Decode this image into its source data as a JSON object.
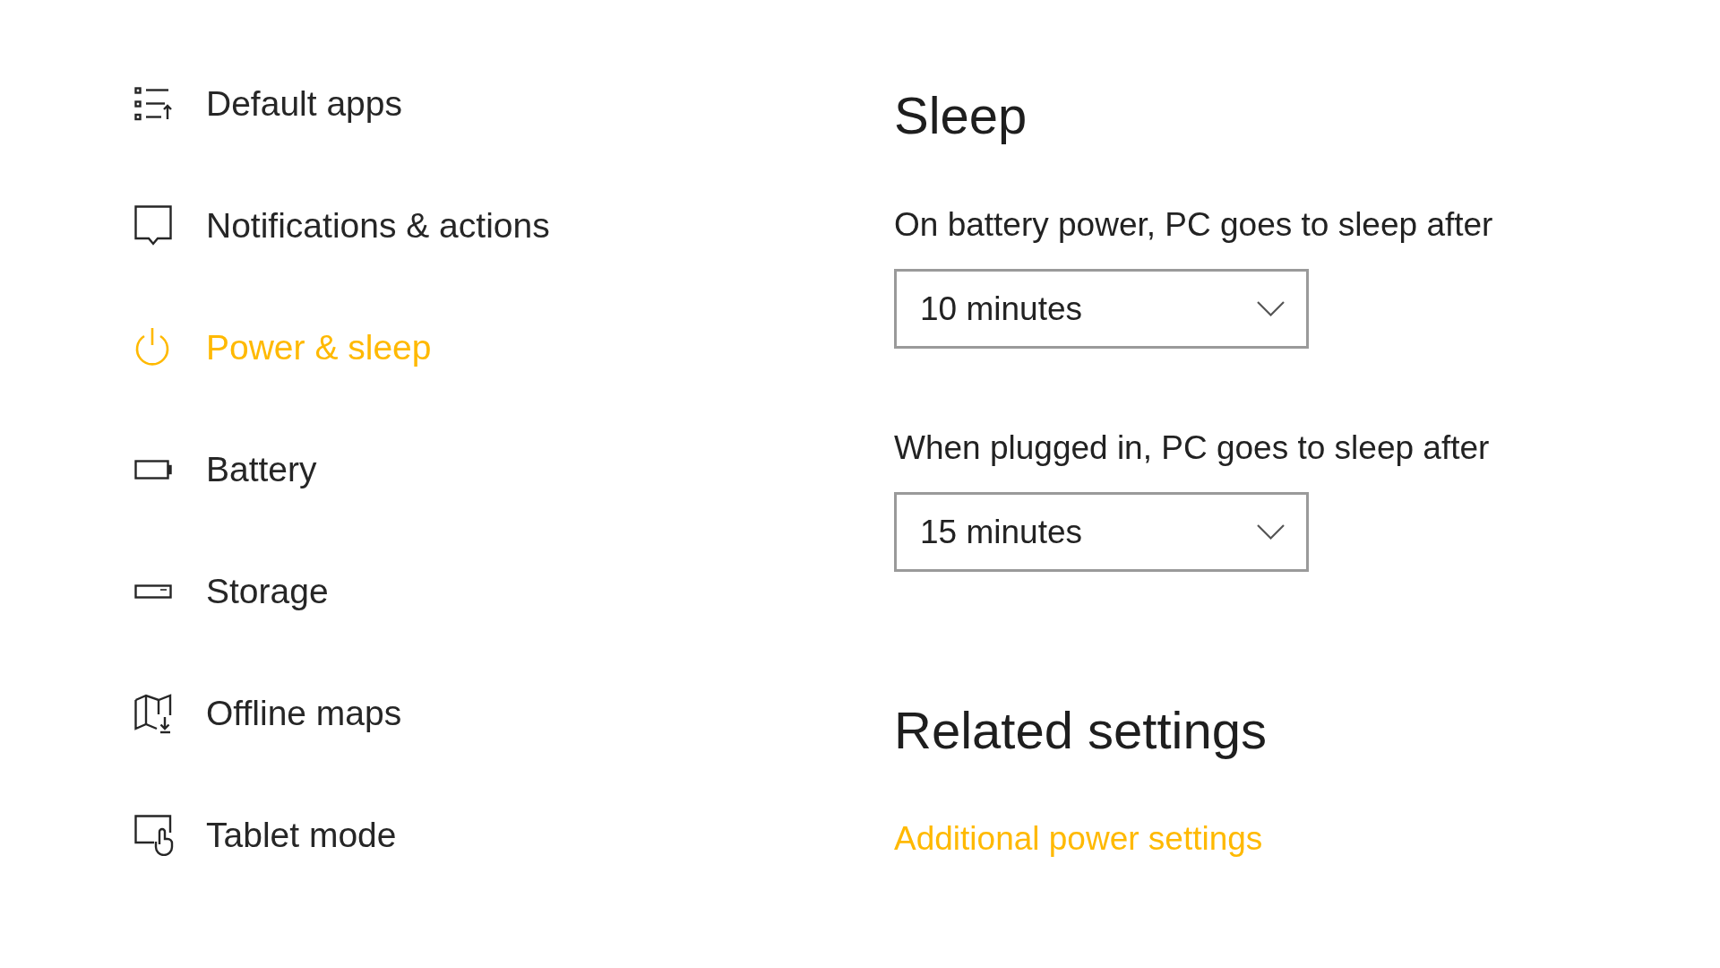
{
  "sidebar": {
    "items": [
      {
        "label": "Default apps",
        "selected": false
      },
      {
        "label": "Notifications & actions",
        "selected": false
      },
      {
        "label": "Power & sleep",
        "selected": true
      },
      {
        "label": "Battery",
        "selected": false
      },
      {
        "label": "Storage",
        "selected": false
      },
      {
        "label": "Offline maps",
        "selected": false
      },
      {
        "label": "Tablet mode",
        "selected": false
      }
    ]
  },
  "sleep": {
    "title": "Sleep",
    "settings": [
      {
        "label": "On battery power, PC goes to sleep after",
        "value": "10 minutes"
      },
      {
        "label": "When plugged in, PC goes to sleep after",
        "value": "15 minutes"
      }
    ]
  },
  "related_settings": {
    "title": "Related settings",
    "links": [
      "Additional power settings"
    ]
  }
}
